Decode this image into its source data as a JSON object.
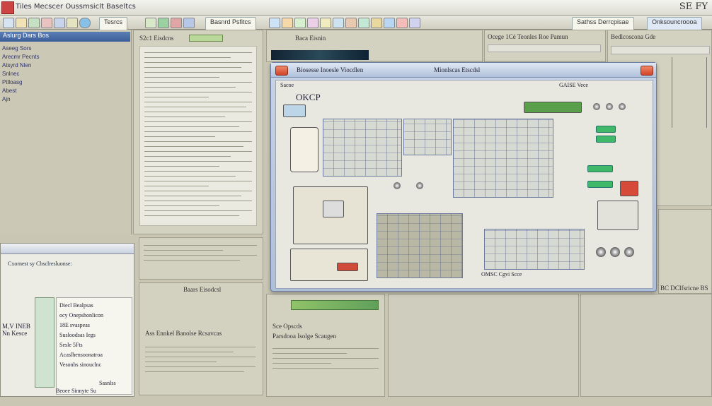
{
  "app": {
    "title": "Tiles Mecscer Oussmsiclt Baseltcs",
    "top_right": "SE FY"
  },
  "toolbar": {
    "tabs": [
      "Tesrcs",
      "Basnrd Psfitcs",
      "Sathss Derrcpisae"
    ],
    "right_label": "Onksouncroooa"
  },
  "sidebar": {
    "header": "Aslurg Dars Bos",
    "items": [
      "Aseeg Sors",
      "Arecmr Pecnts",
      "Atsyrd Nlen",
      "Snlnec",
      "Ptlloasg",
      "Abest",
      "Ajn"
    ]
  },
  "panels": {
    "p1_title": "S2c1 Eisdcns",
    "p2_title": "Baca Eisnin",
    "p3_title": "Ocege 1Cé Teonles Roe Pamun",
    "p4_title": "Bedlcoscona Gde",
    "p5_title": "Baars Eisodcsl",
    "p6_title": "Sce Opscds",
    "p7_title": "Parsdooa Isolge Scaugen",
    "p8_title": "Ass Ennkel Banolse Rcsavcas",
    "right_status": "BC DCIfsricne BS"
  },
  "modal": {
    "title": "Biosesse Inoesle Viocdlen",
    "title_right": "Mionlscas Etscdsl",
    "status_left": "Sacoe",
    "status_right": "GAISE Vece",
    "label_main": "OKCP",
    "bottom_label": "OMSC Cgvi Scce"
  },
  "dialog2": {
    "title": "Cxornest sy Cbsclresluonse:",
    "left_label": "M,V INEB\nNn Kesce",
    "lines": [
      "Diecl Bealpsas",
      "ocy Onepshonlicon",
      "18E svaspeas",
      "Susloodsas Iegs",
      "Sesle 5Fts",
      "Acaslhensoonatroa",
      "Vesonbs sinouclnc",
      "Sasnlss"
    ],
    "bottom": "Beoee Sinnyte Su"
  },
  "colors": {
    "background": "#c9c7b4",
    "modal_frame": "#aebfd8",
    "accent_green": "#3fb86a",
    "accent_red": "#d0442a",
    "accent_blue": "#3c5f99"
  }
}
